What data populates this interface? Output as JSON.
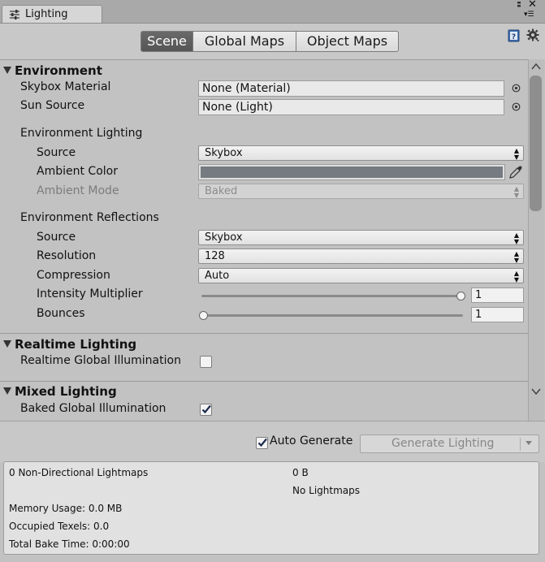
{
  "window": {
    "tab_title": "Lighting"
  },
  "toolbar": {
    "tabs": [
      "Scene",
      "Global Maps",
      "Object Maps"
    ],
    "active_tab": "Scene"
  },
  "environment": {
    "header": "Environment",
    "skybox_material_label": "Skybox Material",
    "skybox_material_value": "None (Material)",
    "sun_source_label": "Sun Source",
    "sun_source_value": "None (Light)",
    "env_lighting": {
      "label": "Environment Lighting",
      "source_label": "Source",
      "source_value": "Skybox",
      "ambient_color_label": "Ambient Color",
      "ambient_color": "#767b81",
      "ambient_mode_label": "Ambient Mode",
      "ambient_mode_value": "Baked"
    },
    "env_reflections": {
      "label": "Environment Reflections",
      "source_label": "Source",
      "source_value": "Skybox",
      "resolution_label": "Resolution",
      "resolution_value": "128",
      "compression_label": "Compression",
      "compression_value": "Auto",
      "intensity_label": "Intensity Multiplier",
      "intensity_value": "1",
      "intensity_fraction": 1.0,
      "bounces_label": "Bounces",
      "bounces_value": "1",
      "bounces_fraction": 0.0
    }
  },
  "realtime": {
    "header": "Realtime Lighting",
    "rtgi_label": "Realtime Global Illumination",
    "rtgi_checked": false
  },
  "mixed": {
    "header": "Mixed Lighting",
    "bakedgi_label": "Baked Global Illumination",
    "bakedgi_checked": true
  },
  "generate": {
    "auto_label": "Auto Generate",
    "auto_checked": true,
    "button_label": "Generate Lighting"
  },
  "stats": {
    "lightmaps": "0 Non-Directional Lightmaps",
    "size": "0 B",
    "no_lightmaps": "No Lightmaps",
    "memory": "Memory Usage: 0.0 MB",
    "texels": "Occupied Texels: 0.0",
    "bake_time": "Total Bake Time: 0:00:00"
  },
  "icons": {
    "tab": "sliders-icon",
    "help": "help-book-icon",
    "gear": "gear-icon",
    "eyedropper": "eyedropper-icon",
    "picker": "object-picker-icon"
  }
}
